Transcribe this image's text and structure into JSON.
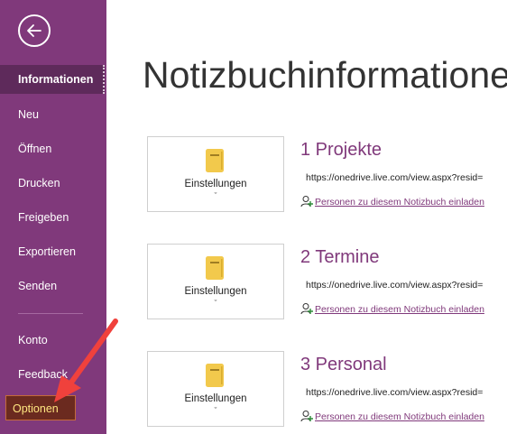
{
  "sidebar": {
    "back_icon": "back-arrow-icon",
    "items": [
      {
        "label": "Informationen"
      },
      {
        "label": "Neu"
      },
      {
        "label": "Öffnen"
      },
      {
        "label": "Drucken"
      },
      {
        "label": "Freigeben"
      },
      {
        "label": "Exportieren"
      },
      {
        "label": "Senden"
      },
      {
        "label": "Konto"
      },
      {
        "label": "Feedback"
      },
      {
        "label": "Optionen"
      }
    ],
    "active": "Informationen",
    "colors": {
      "background": "#80397B",
      "active": "#5E2A5B"
    }
  },
  "main": {
    "title": "Notizbuchinformationen",
    "notebooks": [
      {
        "settings_label": "Einstellungen",
        "chevron": "ˇ",
        "title": "1 Projekte",
        "url": "https://onedrive.live.com/view.aspx?resid=",
        "invite": "Personen zu diesem Notizbuch einladen"
      },
      {
        "settings_label": "Einstellungen",
        "chevron": "ˇ",
        "title": "2 Termine",
        "url": "https://onedrive.live.com/view.aspx?resid=",
        "invite": "Personen zu diesem Notizbuch einladen"
      },
      {
        "settings_label": "Einstellungen",
        "chevron": "ˇ",
        "title": "3 Personal",
        "url": "https://onedrive.live.com/view.aspx?resid=",
        "invite": "Personen zu diesem Notizbuch einladen"
      }
    ],
    "colors": {
      "accent": "#80397B",
      "notebook_icon": "#F2C94C"
    }
  },
  "annotation": {
    "arrow_color": "#F0413C",
    "target": "Optionen"
  }
}
